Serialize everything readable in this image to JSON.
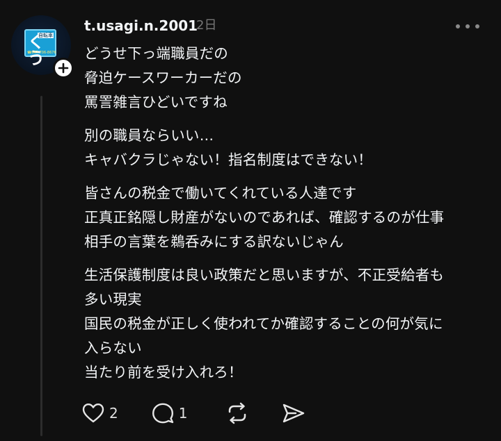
{
  "post": {
    "username": "t.usagi.n.2001",
    "timestamp": "2日",
    "avatar": {
      "sign_big_text": "くう",
      "sign_small_text": "自転車",
      "sign_phone_text": "☎047-706-8676"
    },
    "paragraphs": [
      [
        "どうせ下っ端職員だの",
        "脅迫ケースワーカーだの",
        "罵詈雑言ひどいですね"
      ],
      [
        "別の職員ならいい…",
        "キャバクラじゃない！指名制度はできない！"
      ],
      [
        "皆さんの税金で働いてくれている人達です",
        "正真正銘隠し財産がないのであれば、確認するのが仕事",
        "相手の言葉を鵜呑みにする訳ないじゃん"
      ],
      [
        "生活保護制度は良い政策だと思いますが、不正受給者も",
        "多い現実",
        "国民の税金が正しく使われてか確認することの何が気に",
        "入らない",
        "当たり前を受け入れろ！"
      ]
    ],
    "actions": {
      "like_count": "2",
      "reply_count": "1"
    }
  },
  "icons": {
    "follow": "plus-icon",
    "more": "more-horizontal-icon",
    "like": "heart-icon",
    "reply": "comment-bubble-icon",
    "repost": "repost-icon",
    "share": "send-icon"
  },
  "colors": {
    "background": "#101010",
    "text": "#f3f5f7",
    "secondary": "#777777",
    "thread_line": "#2c2c2c",
    "sign_blue": "#1aa0d6"
  }
}
